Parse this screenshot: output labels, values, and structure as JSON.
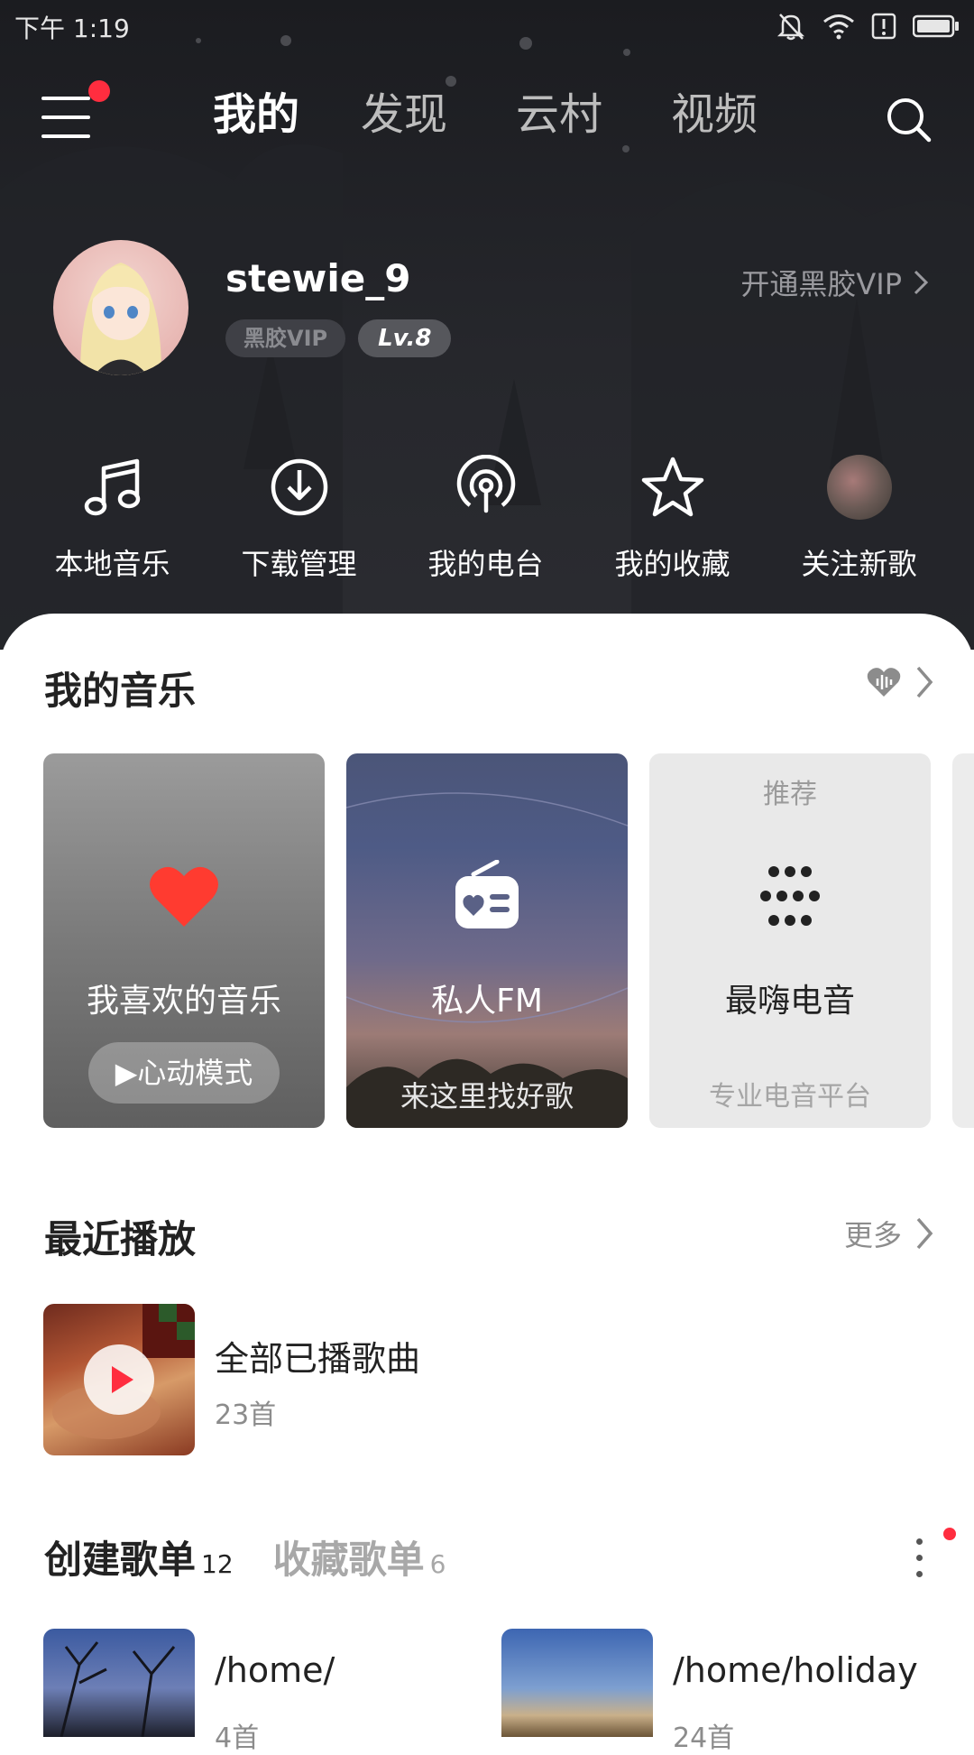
{
  "status_bar": {
    "time": "下午 1:19"
  },
  "nav": {
    "tabs": [
      "我的",
      "发现",
      "云村",
      "视频"
    ]
  },
  "profile": {
    "username": "stewie_9",
    "vip_badge": "黑胶VIP",
    "level": "Lv.8",
    "vip_link": "开通黑胶VIP"
  },
  "quick_actions": [
    {
      "label": "本地音乐",
      "icon": "music-note-icon"
    },
    {
      "label": "下载管理",
      "icon": "download-icon"
    },
    {
      "label": "我的电台",
      "icon": "podcast-icon"
    },
    {
      "label": "我的收藏",
      "icon": "star-icon"
    },
    {
      "label": "关注新歌",
      "icon": "avatar"
    }
  ],
  "my_music": {
    "title": "我的音乐",
    "cards": [
      {
        "title": "我喜欢的音乐",
        "button": "心动模式"
      },
      {
        "title": "私人FM",
        "subtitle": "来这里找好歌"
      },
      {
        "tag": "推荐",
        "title": "最嗨电音",
        "subtitle": "专业电音平台"
      }
    ]
  },
  "recent": {
    "title": "最近播放",
    "more": "更多",
    "item_title": "全部已播歌曲",
    "item_count": "23首"
  },
  "playlists": {
    "created_label": "创建歌单",
    "created_count": "12",
    "collected_label": "收藏歌单",
    "collected_count": "6",
    "items": [
      {
        "name": "/home/",
        "count": "4首"
      },
      {
        "name": "/home/holiday",
        "count": "24首"
      }
    ]
  },
  "colors": {
    "accent_red": "#ff2d3f",
    "header_bg": "#1b1c20"
  }
}
